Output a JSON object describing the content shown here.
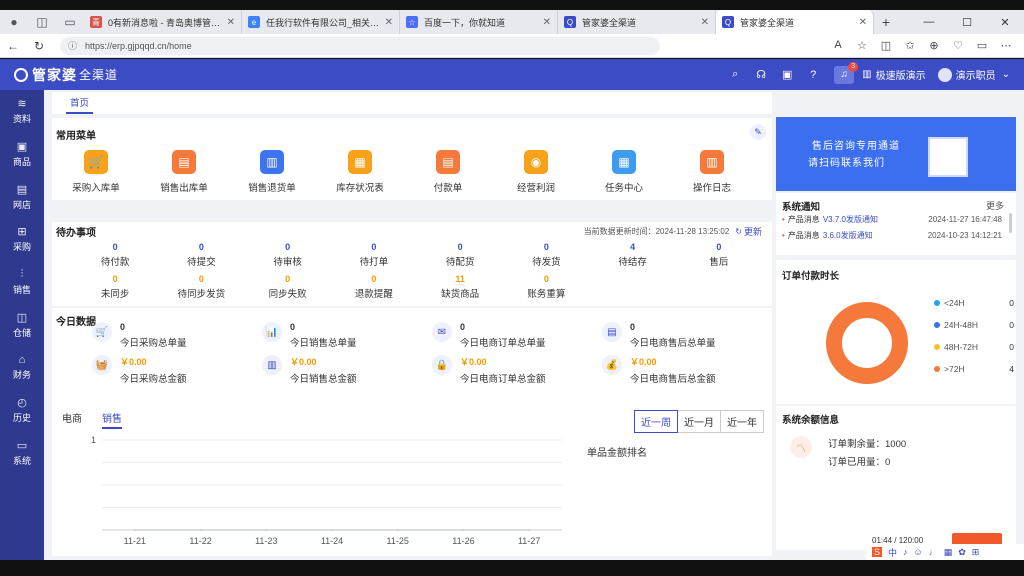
{
  "browser": {
    "tabs": [
      {
        "title": "0有新消息啦 - 青岛奥博管家婆软",
        "fav_color": "#d9534f",
        "fav_glyph": "青"
      },
      {
        "title": "任我行软件有限公司_相关搜索结",
        "fav_color": "#3b82f6",
        "fav_glyph": "e"
      },
      {
        "title": "百度一下，你就知道",
        "fav_color": "#4f6ef7",
        "fav_glyph": "☆"
      },
      {
        "title": "管家婆全渠道",
        "fav_color": "#3b4cc5",
        "fav_glyph": "Q"
      },
      {
        "title": "管家婆全渠道",
        "fav_color": "#3b4cc5",
        "fav_glyph": "Q"
      }
    ],
    "url": "https://erp.gjpqqd.cn/home"
  },
  "header": {
    "logo_main": "管家婆",
    "logo_sub": "全渠道",
    "badge_count": "3",
    "speed_demo": "极速版演示",
    "user": "演示职员"
  },
  "sidebar": {
    "items": [
      {
        "label": "资料",
        "icon": "layers-icon",
        "glyph": "≋"
      },
      {
        "label": "商品",
        "icon": "box-icon",
        "glyph": "▣"
      },
      {
        "label": "网店",
        "icon": "store-icon",
        "glyph": "▤"
      },
      {
        "label": "采购",
        "icon": "cart-icon",
        "glyph": "⊞"
      },
      {
        "label": "销售",
        "icon": "chart-icon",
        "glyph": "⫶"
      },
      {
        "label": "仓储",
        "icon": "warehouse-icon",
        "glyph": "◫"
      },
      {
        "label": "财务",
        "icon": "finance-icon",
        "glyph": "⌂"
      },
      {
        "label": "历史",
        "icon": "history-icon",
        "glyph": "◴"
      },
      {
        "label": "系统",
        "icon": "monitor-icon",
        "glyph": "▭"
      }
    ]
  },
  "crumb": {
    "home": "首页"
  },
  "common_menu": {
    "title": "常用菜单",
    "items": [
      {
        "label": "采购入库单",
        "color": "#f7a21a",
        "glyph": "🛒"
      },
      {
        "label": "销售出库单",
        "color": "#f5793b",
        "glyph": "▤"
      },
      {
        "label": "销售退货单",
        "color": "#3c73f0",
        "glyph": "▥"
      },
      {
        "label": "库存状况表",
        "color": "#f7a21a",
        "glyph": "▦"
      },
      {
        "label": "付款单",
        "color": "#f5793b",
        "glyph": "▤"
      },
      {
        "label": "经营利润",
        "color": "#f7a21a",
        "glyph": "◉"
      },
      {
        "label": "任务中心",
        "color": "#3c9cf0",
        "glyph": "▦"
      },
      {
        "label": "操作日志",
        "color": "#f5793b",
        "glyph": "▥"
      }
    ]
  },
  "pending": {
    "title": "待办事项",
    "updated_label": "当前数据更新时间：2024-11-28 13:25:02",
    "refresh": "更新",
    "row1": [
      {
        "n": "0",
        "label": "待付款"
      },
      {
        "n": "0",
        "label": "待提交"
      },
      {
        "n": "0",
        "label": "待审核"
      },
      {
        "n": "0",
        "label": "待打单"
      },
      {
        "n": "0",
        "label": "待配货"
      },
      {
        "n": "0",
        "label": "待发货"
      },
      {
        "n": "4",
        "label": "待结存"
      },
      {
        "n": "0",
        "label": "售后"
      }
    ],
    "row2": [
      {
        "n": "0",
        "label": "未同步"
      },
      {
        "n": "0",
        "label": "待同步发货"
      },
      {
        "n": "0",
        "label": "同步失败"
      },
      {
        "n": "0",
        "label": "退款提醒"
      },
      {
        "n": "11",
        "label": "缺货商品"
      },
      {
        "n": "0",
        "label": "账务重算"
      }
    ]
  },
  "today": {
    "title": "今日数据",
    "items": [
      {
        "v": "0",
        "label": "今日采购总单量",
        "glyph": "🛒",
        "money": false
      },
      {
        "v": "0",
        "label": "今日销售总单量",
        "glyph": "📊",
        "money": false
      },
      {
        "v": "0",
        "label": "今日电商订单总单量",
        "glyph": "✉",
        "money": false
      },
      {
        "v": "0",
        "label": "今日电商售后总单量",
        "glyph": "▤",
        "money": false
      },
      {
        "v": "￥0.00",
        "label": "今日采购总金额",
        "glyph": "🧺",
        "money": true
      },
      {
        "v": "￥0.00",
        "label": "今日销售总金额",
        "glyph": "▥",
        "money": true
      },
      {
        "v": "￥0.00",
        "label": "今日电商订单总金额",
        "glyph": "🔒",
        "money": true
      },
      {
        "v": "￥0.00",
        "label": "今日电商售后总金额",
        "glyph": "💰",
        "money": true
      }
    ]
  },
  "sales_chart": {
    "tabs": [
      "电商",
      "销售"
    ],
    "ranges": [
      "近一周",
      "近一月",
      "近一年"
    ],
    "ranking_title": "单品金额排名"
  },
  "chart_data": {
    "type": "line",
    "categories": [
      "11-21",
      "11-22",
      "11-23",
      "11-24",
      "11-25",
      "11-26",
      "11-27"
    ],
    "series": [
      {
        "values": [
          0,
          0,
          0,
          0,
          0,
          0,
          0
        ]
      }
    ],
    "yticks": [
      "1"
    ],
    "ylim": [
      0,
      1
    ],
    "grid": true
  },
  "banner": {
    "line1": "售后咨询专用通道",
    "line2": "请扫码联系我们"
  },
  "notice": {
    "title": "系统通知",
    "more": "更多",
    "items": [
      {
        "prefix": "产品消息",
        "ver": "V3.7.0发版通知",
        "date": "2024-11-27 16:47:48"
      },
      {
        "prefix": "产品消息",
        "ver": "3.6.0发版通知",
        "date": "2024-10-23 14:12:21"
      }
    ]
  },
  "payment_time": {
    "title": "订单付款时长",
    "legend": [
      {
        "label": "<24H",
        "count": "0",
        "color": "#1fa6e6"
      },
      {
        "label": "24H-48H",
        "count": "0",
        "color": "#3c6ff0"
      },
      {
        "label": "48H-72H",
        "count": "0",
        "color": "#f7c025"
      },
      {
        "label": ">72H",
        "count": "4",
        "color": "#f5793b"
      }
    ]
  },
  "balance": {
    "title": "系统余额信息",
    "remain": "订单剩余量：1000",
    "used": "订单已用量：0",
    "time": "01:44 / 120:00"
  }
}
